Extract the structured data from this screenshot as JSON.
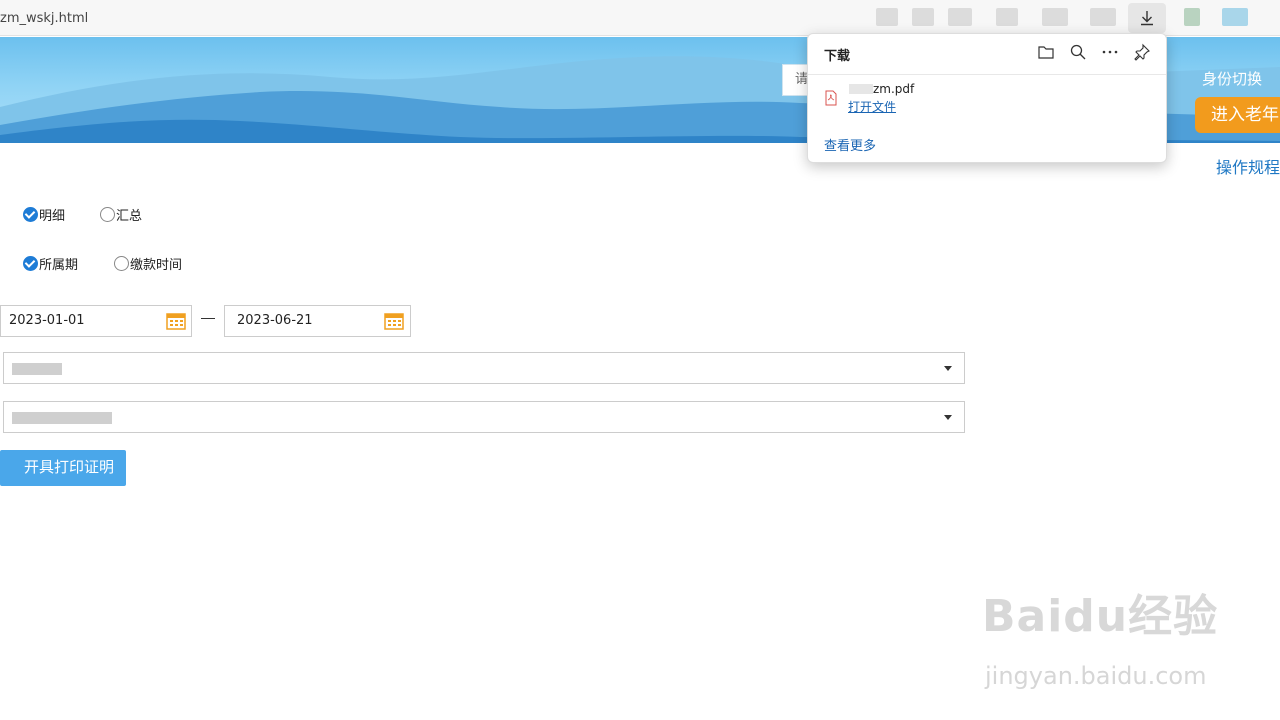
{
  "browser": {
    "url": "zm_wskj.html"
  },
  "banner": {
    "search_placeholder": "请",
    "role_switch": "身份切换",
    "enter_button": "进入老年",
    "ops_link": "操作规程"
  },
  "downloads": {
    "title": "下载",
    "file_name": "zm.pdf",
    "open_file": "打开文件",
    "see_more": "查看更多"
  },
  "form": {
    "type_options": [
      {
        "label": "明细",
        "checked": true
      },
      {
        "label": "汇总",
        "checked": false
      }
    ],
    "period_options": [
      {
        "label": "所属期",
        "checked": true
      },
      {
        "label": "缴款时间",
        "checked": false
      }
    ],
    "date_start": "2023-01-01",
    "date_end": "2023-06-21",
    "submit_label": "开具打印证明"
  },
  "watermark": {
    "brand": "Baidu经验",
    "url": "jingyan.baidu.com"
  },
  "colors": {
    "accent": "#1e7cd6",
    "button": "#4aa7ea",
    "orange": "#f29b1d",
    "link": "#1a65b3"
  }
}
